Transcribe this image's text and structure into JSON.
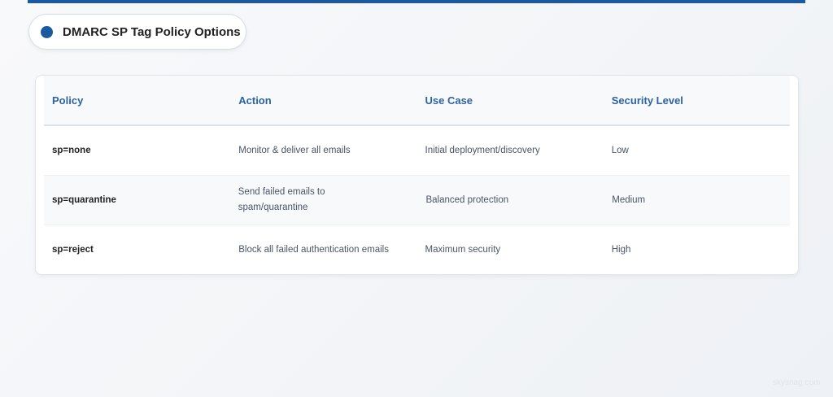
{
  "title": "DMARC SP Tag Policy Options",
  "table": {
    "headers": [
      "Policy",
      "Action",
      "Use Case",
      "Security Level"
    ],
    "rows": [
      [
        "sp=none",
        "Monitor & deliver all emails",
        "Initial deployment/discovery",
        "Low"
      ],
      [
        "sp=quarantine",
        "Send failed emails to spam/quarantine",
        "Balanced protection",
        "Medium"
      ],
      [
        "sp=reject",
        "Block all failed authentication emails",
        "Maximum security",
        "High"
      ]
    ]
  },
  "watermark": "skysnag.com",
  "colors": {
    "accent": "#1c5aa0"
  }
}
